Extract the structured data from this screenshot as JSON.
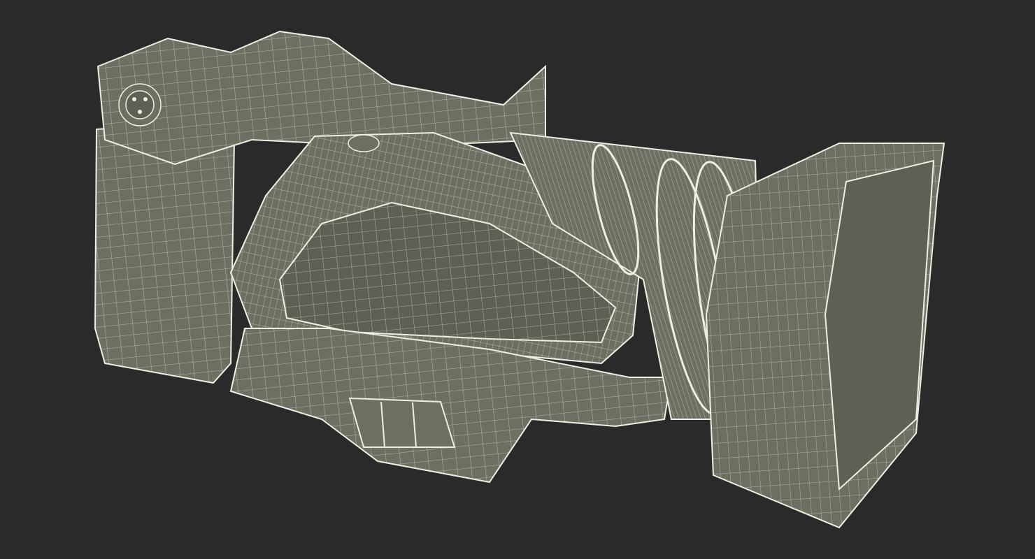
{
  "scene": {
    "background_color": "#2a2a2a",
    "subject": "camcorder-wireframe-model",
    "surface_color": "#6e6e62",
    "surface_shade_color": "#5f5f55",
    "wire_color": "#eeeee2"
  }
}
